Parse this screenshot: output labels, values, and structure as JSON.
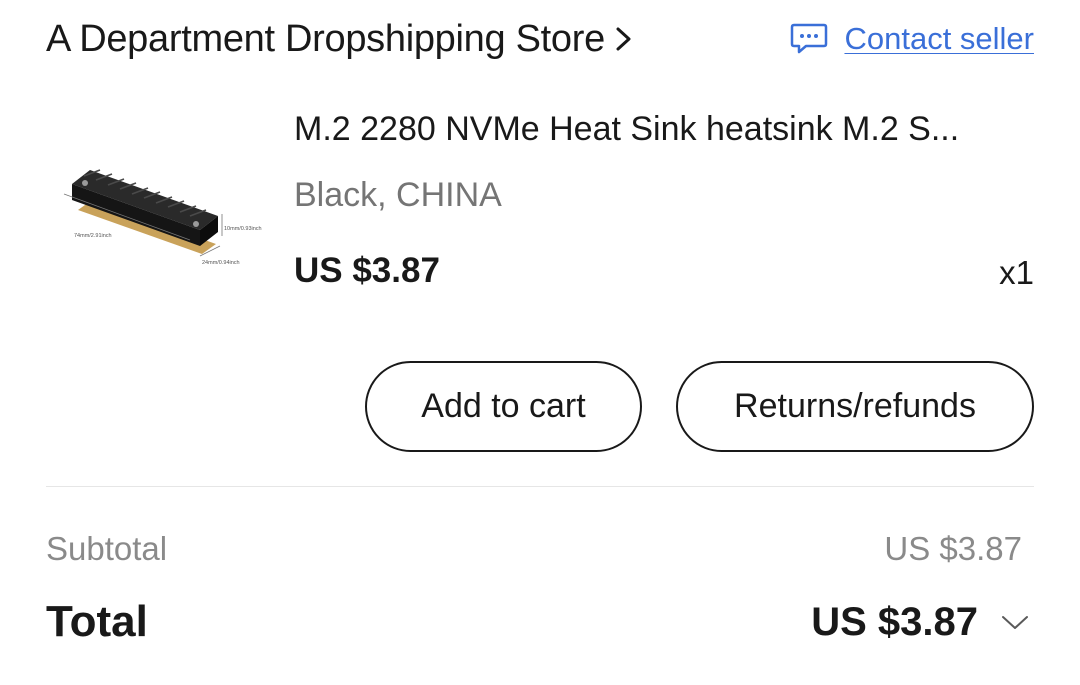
{
  "store": {
    "name": "A Department Dropshipping Store"
  },
  "contact": {
    "label": "Contact seller"
  },
  "product": {
    "title": "M.2 2280 NVMe  Heat Sink heatsink M.2 S...",
    "variant": "Black, CHINA",
    "price": "US $3.87",
    "quantity": "x1",
    "image_labels": {
      "length": "74mm/2.91inch",
      "height": "10mm/0.93inch",
      "width": "24mm/0.94inch"
    }
  },
  "actions": {
    "add_to_cart": "Add to cart",
    "returns": "Returns/refunds"
  },
  "summary": {
    "subtotal_label": "Subtotal",
    "subtotal_value": "US $3.87",
    "total_label": "Total",
    "total_value": "US $3.87"
  },
  "icons": {
    "store_arrow": "chevron-right-icon",
    "contact": "chat-bubble-icon",
    "total_expand": "chevron-down-icon"
  },
  "colors": {
    "link": "#3a6fd8",
    "text": "#191919",
    "muted": "#757575",
    "divider": "#e6e6e6"
  }
}
